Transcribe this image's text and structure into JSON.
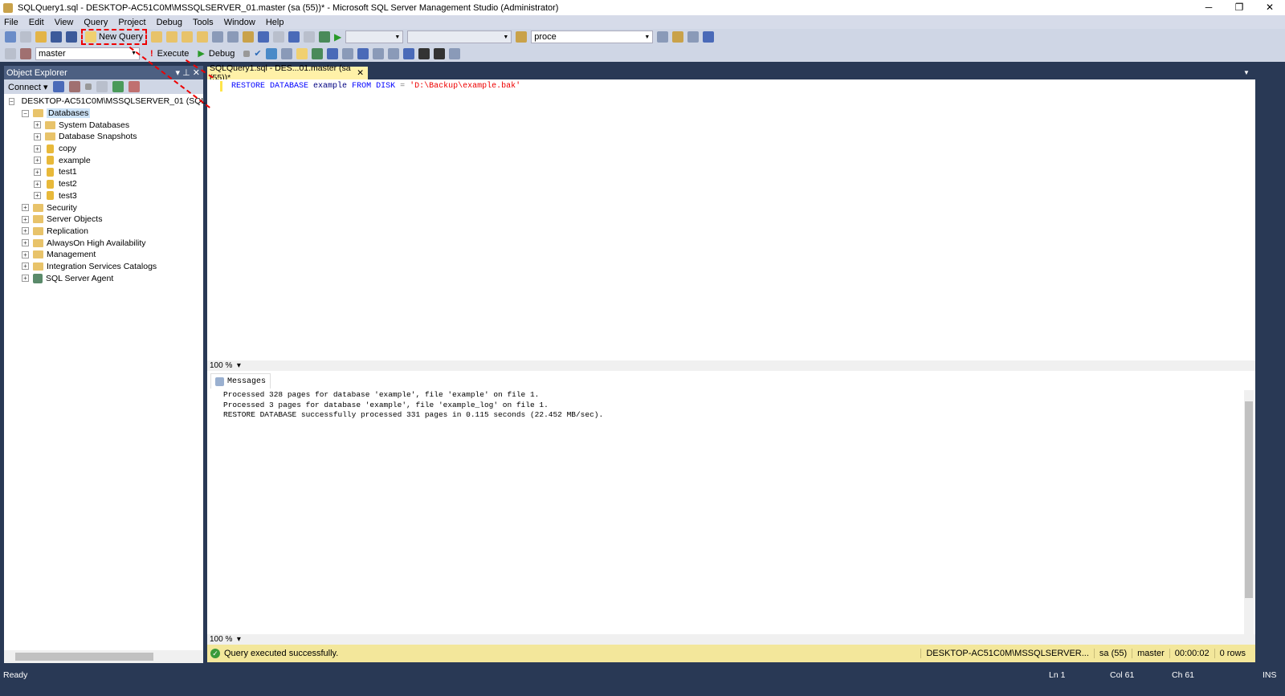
{
  "window": {
    "title": "SQLQuery1.sql - DESKTOP-AC51C0M\\MSSQLSERVER_01.master (sa (55))* - Microsoft SQL Server Management Studio (Administrator)",
    "min": "─",
    "max": "❐",
    "close": "✕"
  },
  "menu": [
    "File",
    "Edit",
    "View",
    "Query",
    "Project",
    "Debug",
    "Tools",
    "Window",
    "Help"
  ],
  "toolbar": {
    "new_query": "New Query",
    "search_combo": "proce",
    "database_combo": "master",
    "execute": "Execute",
    "debug": "Debug"
  },
  "object_explorer": {
    "title": "Object Explorer",
    "connect": "Connect",
    "server": "DESKTOP-AC51C0M\\MSSQLSERVER_01 (SQL Server",
    "databases": "Databases",
    "db_children": [
      "System Databases",
      "Database Snapshots",
      "copy",
      "example",
      "test1",
      "test2",
      "test3"
    ],
    "server_children": [
      "Security",
      "Server Objects",
      "Replication",
      "AlwaysOn High Availability",
      "Management",
      "Integration Services Catalogs",
      "SQL Server Agent"
    ]
  },
  "editor": {
    "tab": "SQLQuery1.sql - DES...01.master (sa (55))*",
    "code_kw1": "RESTORE DATABASE",
    "code_id": "example",
    "code_kw2": "FROM DISK",
    "code_eq": "=",
    "code_str": "'D:\\Backup\\example.bak'",
    "zoom": "100 %"
  },
  "results": {
    "tab": "Messages",
    "zoom": "100 %",
    "messages": [
      "Processed 328 pages for database 'example', file 'example' on file 1.",
      "Processed 3 pages for database 'example', file 'example_log' on file 1.",
      "RESTORE DATABASE successfully processed 331 pages in 0.115 seconds (22.452 MB/sec)."
    ]
  },
  "query_status": {
    "message": "Query executed successfully.",
    "server": "DESKTOP-AC51C0M\\MSSQLSERVER...",
    "user": "sa (55)",
    "database": "master",
    "elapsed": "00:00:02",
    "rows": "0 rows"
  },
  "statusbar": {
    "ready": "Ready",
    "ln": "Ln 1",
    "col": "Col 61",
    "ch": "Ch 61",
    "ins": "INS"
  },
  "colors": {
    "frame": "#293955",
    "highlight": "#e00000",
    "status_yellow": "#f3e79b"
  }
}
